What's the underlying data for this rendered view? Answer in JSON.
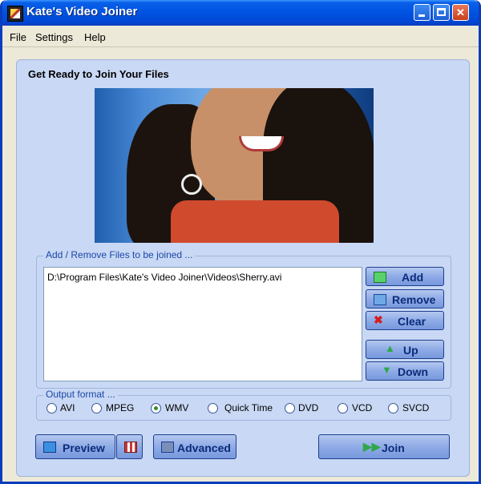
{
  "window": {
    "title": "Kate's Video Joiner"
  },
  "menu": {
    "items": [
      "File",
      "Settings",
      "Help"
    ]
  },
  "panel": {
    "title": "Get Ready to Join Your Files"
  },
  "files_group": {
    "label": "Add / Remove Files to be joined ...",
    "files": [
      "D:\\Program Files\\Kate's Video Joiner\\Videos\\Sherry.avi"
    ]
  },
  "buttons": {
    "add": "Add",
    "remove": "Remove",
    "clear": "Clear",
    "up": "Up",
    "down": "Down",
    "preview": "Preview",
    "advanced": "Advanced",
    "join": "Join"
  },
  "output": {
    "label": "Output format ...",
    "options": [
      "AVI",
      "MPEG",
      "WMV",
      "Quick Time",
      "DVD",
      "VCD",
      "SVCD"
    ],
    "selected": "WMV"
  },
  "colors": {
    "title_bar": "#0053e1",
    "panel": "#c9d8f4",
    "button": "#8fabe6",
    "group_label": "#1b48a8"
  }
}
